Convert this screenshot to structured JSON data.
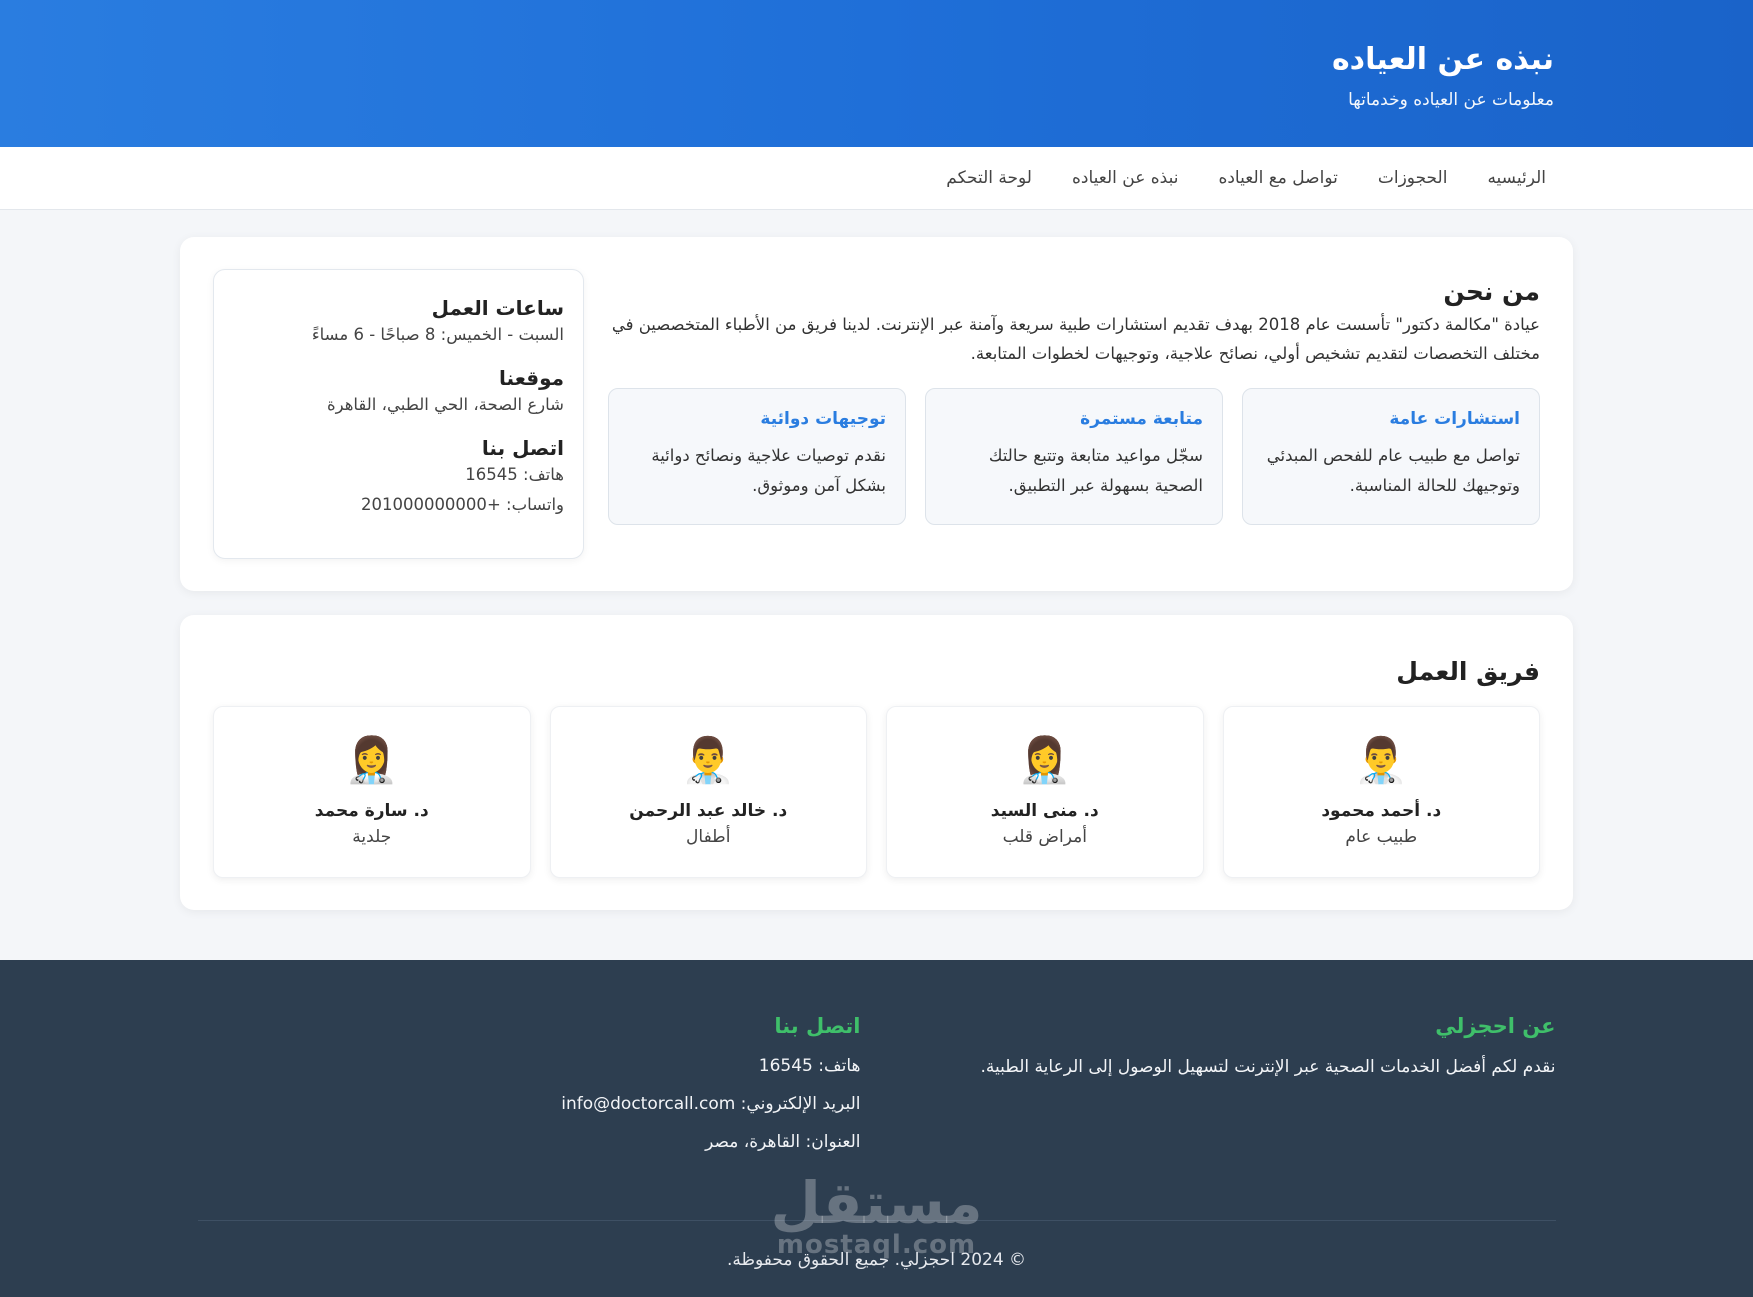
{
  "header": {
    "title": "نبذه عن العياده",
    "subtitle": "معلومات عن العياده وخدماتها"
  },
  "nav": {
    "items": [
      "الرئيسيه",
      "الحجوزات",
      "تواصل مع العياده",
      "نبذه عن العياده",
      "لوحة التحكم"
    ]
  },
  "about": {
    "heading": "من نحن",
    "description": "عيادة \"مكالمة دكتور\" تأسست عام 2018 بهدف تقديم استشارات طبية سريعة وآمنة عبر الإنترنت. لدينا فريق من الأطباء المتخصصين في مختلف التخصصات لتقديم تشخيص أولي، نصائح علاجية، وتوجيهات لخطوات المتابعة.",
    "services": [
      {
        "title": "استشارات عامة",
        "text": "تواصل مع طبيب عام للفحص المبدئي وتوجيهك للحالة المناسبة."
      },
      {
        "title": "متابعة مستمرة",
        "text": "سجّل مواعيد متابعة وتتبع حالتك الصحية بسهولة عبر التطبيق."
      },
      {
        "title": "توجيهات دوائية",
        "text": "نقدم توصيات علاجية ونصائح دوائية بشكل آمن وموثوق."
      }
    ]
  },
  "sidebar": {
    "hours_heading": "ساعات العمل",
    "hours_text": "السبت - الخميس: 8 صباحًا - 6 مساءً",
    "location_heading": "موقعنا",
    "location_text": "شارع الصحة، الحي الطبي، القاهرة",
    "contact_heading": "اتصل بنا",
    "phone": "هاتف: 16545",
    "whatsapp": "واتساب: +201000000000"
  },
  "team": {
    "heading": "فريق العمل",
    "members": [
      {
        "emoji": "👨‍⚕️",
        "name": "د. أحمد محمود",
        "specialty": "طبيب عام"
      },
      {
        "emoji": "👩‍⚕️",
        "name": "د. منى السيد",
        "specialty": "أمراض قلب"
      },
      {
        "emoji": "👨‍⚕️",
        "name": "د. خالد عبد الرحمن",
        "specialty": "أطفال"
      },
      {
        "emoji": "👩‍⚕️",
        "name": "د. سارة محمد",
        "specialty": "جلدية"
      }
    ]
  },
  "footer": {
    "about_heading": "عن احجزلي",
    "about_text": "نقدم لكم أفضل الخدمات الصحية عبر الإنترنت لتسهيل الوصول إلى الرعاية الطبية.",
    "contact_heading": "اتصل بنا",
    "phone": "هاتف: 16545",
    "email": "البريد الإلكتروني: info@doctorcall.com",
    "address": "العنوان: القاهرة، مصر",
    "copyright": "© 2024 احجزلي. جميع الحقوق محفوظة.",
    "accent_color": "#3fbf6a"
  },
  "watermark": {
    "arabic": "مستقل",
    "latin": "mostaql.com"
  },
  "colors": {
    "header_blue": "#2a7de0",
    "footer_bg": "#2d3e50",
    "service_title": "#2a7de0"
  }
}
